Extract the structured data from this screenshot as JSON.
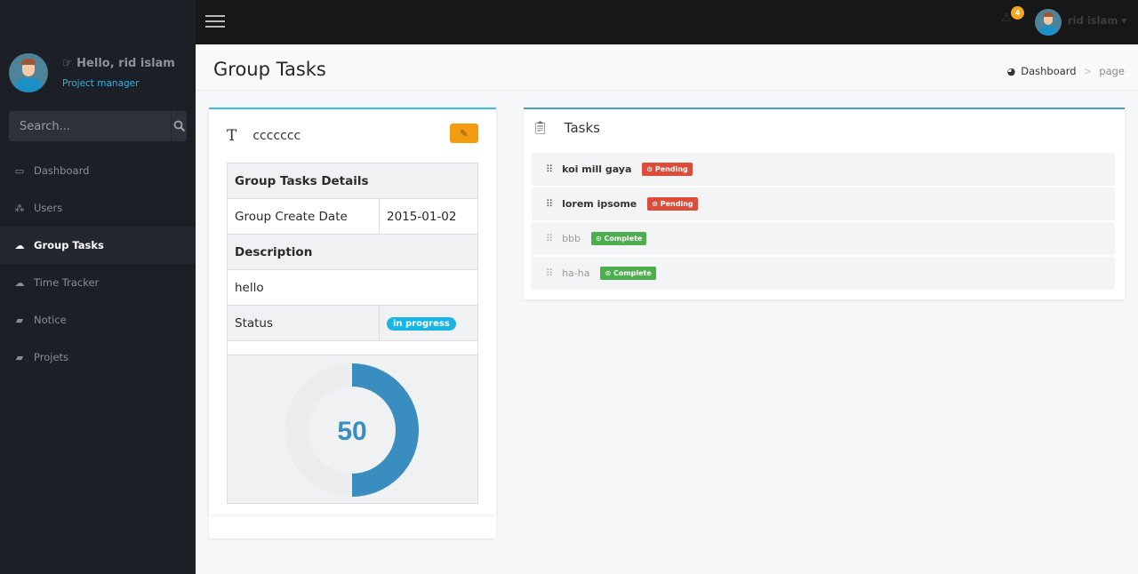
{
  "sidebar": {
    "greeting": "☞ Hello, rid islam",
    "role": "Project manager",
    "search_placeholder": "Search...",
    "items": [
      {
        "label": "Dashboard",
        "icon": "laptop-icon",
        "glyph": "▭",
        "active": false
      },
      {
        "label": "Users",
        "icon": "sitemap-icon",
        "glyph": "⁂",
        "active": false
      },
      {
        "label": "Group Tasks",
        "icon": "cloud-download-icon",
        "glyph": "☁",
        "active": true
      },
      {
        "label": "Time Tracker",
        "icon": "cloud-download-icon",
        "glyph": "☁",
        "active": false
      },
      {
        "label": "Notice",
        "icon": "folder-open-icon",
        "glyph": "▰",
        "active": false
      },
      {
        "label": "Projets",
        "icon": "folder-open-icon",
        "glyph": "▰",
        "active": false
      }
    ]
  },
  "topbar": {
    "notification_count": "4",
    "user_name": "rid islam ▾"
  },
  "header": {
    "title": "Group Tasks",
    "breadcrumb": [
      "Dashboard",
      "page"
    ],
    "breadcrumb_sep": ">"
  },
  "group": {
    "name": "ccccccc",
    "details_header": "Group Tasks Details",
    "create_date_label": "Group Create Date",
    "create_date": "2015-01-02",
    "description_label": "Description",
    "description": "hello",
    "status_label": "Status",
    "status": "in progress",
    "progress_label": "50",
    "progress_fraction": 0.5,
    "colors": {
      "accent": "#3a8ebf",
      "edit_button": "#f39c12",
      "status": "#17b4e6"
    }
  },
  "tasks": {
    "title": "Tasks",
    "items": [
      {
        "name": "koi mill gaya",
        "status": "⊙ Pending",
        "done": false
      },
      {
        "name": "lorem ipsome",
        "status": "⊙ Pending",
        "done": false
      },
      {
        "name": "bbb",
        "status": "⊙ Complete",
        "done": true
      },
      {
        "name": "ha-ha",
        "status": "⊙ Complete",
        "done": true
      }
    ]
  }
}
